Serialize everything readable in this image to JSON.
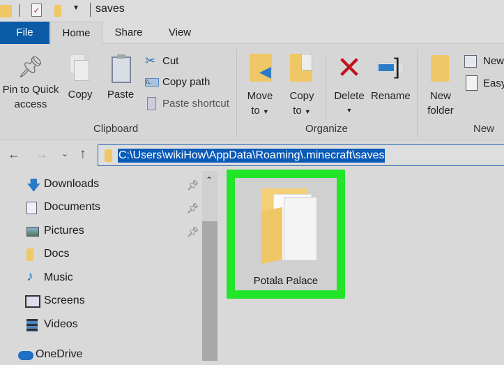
{
  "title_bar": {
    "title": "saves",
    "icons": [
      "folder-icon",
      "properties-icon",
      "new-folder-icon",
      "customize-dropdown-icon"
    ]
  },
  "tabs": [
    {
      "label": "File",
      "active": false
    },
    {
      "label": "Home",
      "active": true
    },
    {
      "label": "Share"
    },
    {
      "label": "View"
    }
  ],
  "ribbon": {
    "clipboard": {
      "label": "Clipboard",
      "pin": "Pin to Quick",
      "pin2": "access",
      "copy": "Copy",
      "paste": "Paste",
      "cut": "Cut",
      "copy_path": "Copy path",
      "paste_shortcut": "Paste shortcut"
    },
    "organize": {
      "label": "Organize",
      "move": "Move",
      "move2": "to",
      "copy": "Copy",
      "copy2": "to",
      "delete": "Delete",
      "rename": "Rename"
    },
    "new": {
      "label": "New",
      "new_folder": "New",
      "new_folder2": "folder",
      "new_item": "New",
      "easy_access": "Easy"
    }
  },
  "address": {
    "path": "C:\\Users\\wikiHow\\AppData\\Roaming\\.minecraft\\saves"
  },
  "nav_pane": {
    "items": [
      {
        "label": "Downloads",
        "icon": "download-arrow-icon",
        "pinned": true
      },
      {
        "label": "Documents",
        "icon": "documents-icon",
        "pinned": true
      },
      {
        "label": "Pictures",
        "icon": "pictures-icon",
        "pinned": true
      },
      {
        "label": "Docs",
        "icon": "folder-icon",
        "pinned": false
      },
      {
        "label": "Music",
        "icon": "music-note-icon",
        "pinned": false
      },
      {
        "label": "Screens",
        "icon": "screens-icon",
        "pinned": false
      },
      {
        "label": "Videos",
        "icon": "videos-icon",
        "pinned": false
      },
      {
        "label": "OneDrive",
        "icon": "cloud-icon",
        "pinned": false
      }
    ]
  },
  "content": {
    "items": [
      {
        "label": "Potala Palace",
        "selected": true,
        "highlight_color": "#22e52a"
      }
    ]
  },
  "colors": {
    "file_tab": "#0a5aa6",
    "selection": "#0a5ab8",
    "highlight": "#22e52a"
  }
}
